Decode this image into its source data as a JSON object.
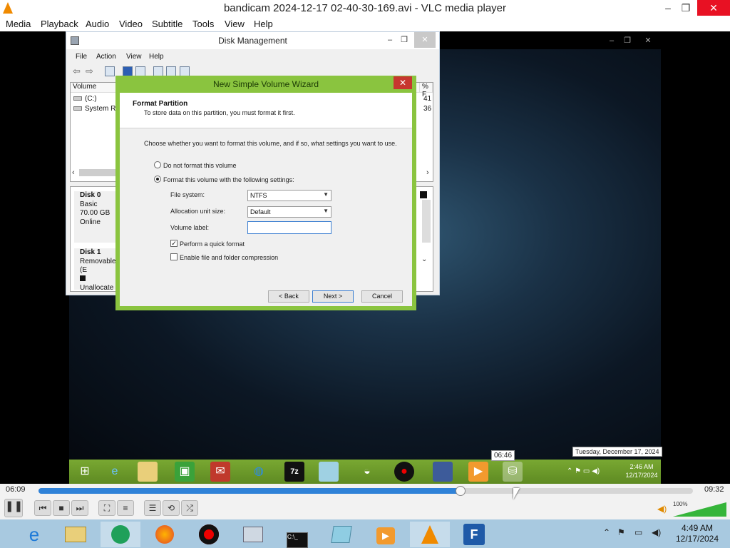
{
  "vlc": {
    "title": "bandicam 2024-12-17 02-40-30-169.avi - VLC media player",
    "menu": [
      "Media",
      "Playback",
      "Audio",
      "Video",
      "Subtitle",
      "Tools",
      "View",
      "Help"
    ],
    "win_min": "–",
    "win_restore": "❐",
    "win_close": "✕",
    "time_elapsed": "06:09",
    "time_total": "09:32",
    "progress": 0.645,
    "hover_time": "06:46",
    "volume_label": "100%",
    "volume": 1.0
  },
  "disk_management": {
    "title": "Disk Management",
    "menu": [
      "File",
      "Action",
      "View",
      "Help"
    ],
    "columns": [
      "Volume",
      "% F"
    ],
    "volumes": [
      {
        "name": "(C:)",
        "pct": "41"
      },
      {
        "name": "System Res",
        "pct": "36"
      }
    ],
    "disks": [
      {
        "name": "Disk 0",
        "type": "Basic",
        "size": "70.00 GB",
        "status": "Online"
      },
      {
        "name": "Disk 1",
        "type": "Removable (E",
        "status": "Unallocate"
      }
    ]
  },
  "wizard": {
    "title": "New Simple Volume Wizard",
    "close": "✕",
    "heading": "Format Partition",
    "subheading": "To store data on this partition, you must format it first.",
    "instruction": "Choose whether you want to format this volume, and if so, what settings you want to use.",
    "opt_no_format": "Do not format this volume",
    "opt_format": "Format this volume with the following settings:",
    "fs_label": "File system:",
    "fs_value": "NTFS",
    "alloc_label": "Allocation unit size:",
    "alloc_value": "Default",
    "vol_label": "Volume label:",
    "vol_value": "",
    "quick_format": "Perform a quick format",
    "compression": "Enable file and folder compression",
    "back": "< Back",
    "next": "Next >",
    "cancel": "Cancel"
  },
  "guest_taskbar": {
    "tooltip_date": "Tuesday, December 17, 2024",
    "time": "2:46 AM",
    "date": "12/17/2024",
    "icons": [
      "windows-start-icon",
      "internet-explorer-icon",
      "file-explorer-icon",
      "store-icon",
      "app-red-icon",
      "globe-icon",
      "7zip-icon",
      "notepad-icon",
      "hat-icon",
      "record-icon",
      "network-icon",
      "media-player-icon",
      "disk-management-icon"
    ]
  },
  "host_taskbar": {
    "time": "4:49 AM",
    "date": "12/17/2024",
    "icons": [
      "internet-explorer-icon",
      "file-explorer-icon",
      "bandicam-green-icon",
      "firefox-icon",
      "record-icon",
      "performance-monitor-icon",
      "command-prompt-icon",
      "notepad-icon",
      "media-player-icon",
      "vlc-icon",
      "filezilla-icon"
    ]
  },
  "colors": {
    "wizard_border": "#8ac43f",
    "seek_fill": "#2f82d8",
    "close_red": "#e81123"
  }
}
